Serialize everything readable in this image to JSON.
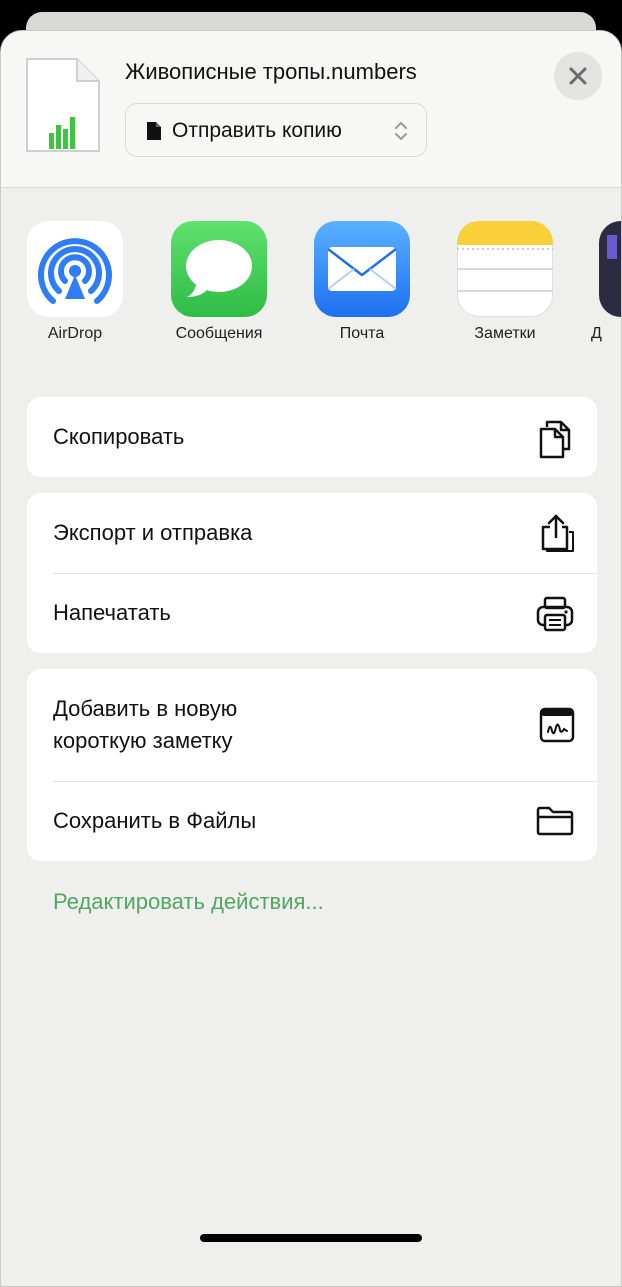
{
  "header": {
    "file_name": "Живописные тропы.numbers",
    "send_option": "Отправить копию"
  },
  "share_targets": [
    {
      "name": "AirDrop",
      "icon": "airdrop-icon"
    },
    {
      "name": "Сообщения",
      "icon": "messages-icon"
    },
    {
      "name": "Почта",
      "icon": "mail-icon"
    },
    {
      "name": "Заметки",
      "icon": "notes-icon"
    },
    {
      "name": "Д",
      "icon": "partial-app-icon"
    }
  ],
  "actions": {
    "copy": "Скопировать",
    "export": "Экспорт и отправка",
    "print": "Напечатать",
    "quick_note_line1": "Добавить в новую",
    "quick_note_line2": "короткую заметку",
    "save_files": "Сохранить в Файлы"
  },
  "edit_actions": "Редактировать действия...",
  "colors": {
    "accent_green": "#4fa762",
    "numbers_green": "#3cc640",
    "mail_blue": "#2f7df6",
    "messages_green": "#36c84c",
    "notes_yellow": "#f9cf3a"
  }
}
